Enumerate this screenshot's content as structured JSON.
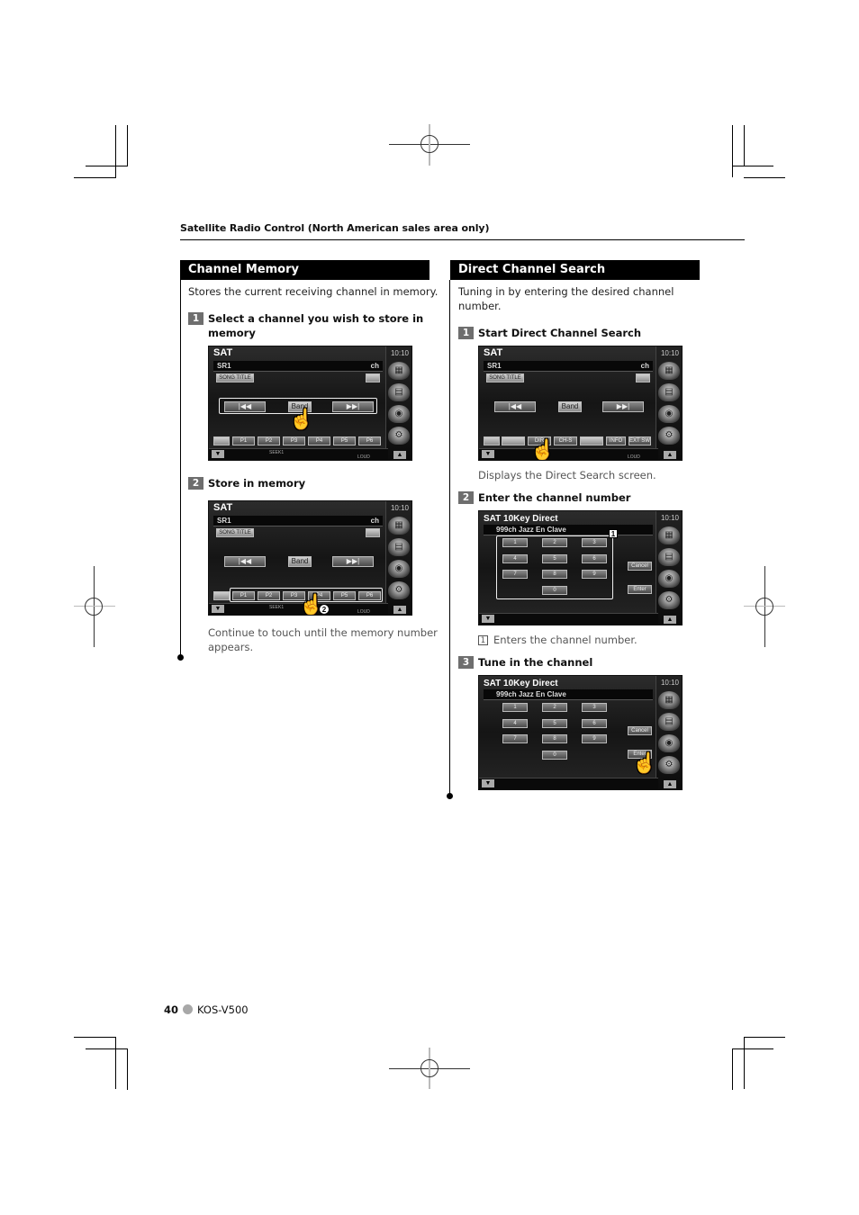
{
  "running_head": "Satellite Radio Control (North American sales area only)",
  "footer": {
    "page_number": "40",
    "model": "KOS-V500"
  },
  "left_section": {
    "title": "Channel Memory",
    "intro": "Stores the current receiving channel in memory.",
    "steps": [
      {
        "num": "1",
        "label_line1": "Select a channel you wish to store in",
        "label_line2": "memory"
      },
      {
        "num": "2",
        "label": "Store in memory",
        "note_line1": "Continue to touch until the memory number",
        "note_line2": "appears."
      }
    ]
  },
  "right_section": {
    "title": "Direct Channel Search",
    "intro_line1": "Tuning in by entering the desired channel",
    "intro_line2": "number.",
    "steps": [
      {
        "num": "1",
        "label": "Start Direct Channel Search",
        "note": "Displays the Direct Search screen."
      },
      {
        "num": "2",
        "label": "Enter the channel number",
        "note_num": "1",
        "note": "Enters the channel number."
      },
      {
        "num": "3",
        "label": "Tune in the channel"
      }
    ]
  },
  "screens": {
    "sat": {
      "title": "SAT",
      "clock": "10:10",
      "band_row": "SR1",
      "ch_label": "ch",
      "song_title_btn": "SONG TITLE",
      "prev_btn": "|◀◀",
      "band_btn": "Band",
      "next_btn": "▶▶|",
      "presets": [
        "P1",
        "P2",
        "P3",
        "P4",
        "P5",
        "P6"
      ],
      "function_bar": [
        "",
        "",
        "DIR",
        "CH-S",
        "",
        "INFO",
        "EXT SW"
      ],
      "footer_seek": "SEEK1",
      "footer_loud": "LOUD"
    },
    "direct": {
      "title": "SAT 10Key Direct",
      "clock": "10:10",
      "channel_info": "999ch Jazz En Clave",
      "keys": [
        "1",
        "2",
        "3",
        "4",
        "5",
        "6",
        "7",
        "8",
        "9",
        "0"
      ],
      "cancel_btn": "Cancel",
      "enter_btn": "Enter",
      "callout": "1"
    },
    "store_callout": "2"
  }
}
